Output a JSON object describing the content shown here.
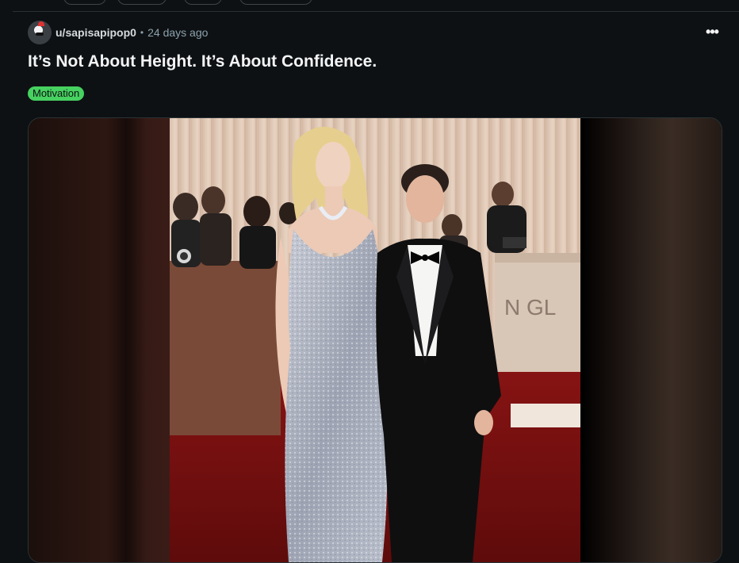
{
  "post": {
    "author": "u/sapisapipop0",
    "separator": "•",
    "timestamp": "24 days ago",
    "more_label": "•••",
    "title": "It’s Not About Height. It’s About Confidence.",
    "flair": "Motivation",
    "media": {
      "backdrop_text": "N GL"
    }
  },
  "colors": {
    "background": "#0e1113",
    "flair": "#46d160",
    "meta_text": "#8ba2ad"
  },
  "icons": {
    "avatar": "avatar-icon",
    "more": "more-options-icon"
  }
}
